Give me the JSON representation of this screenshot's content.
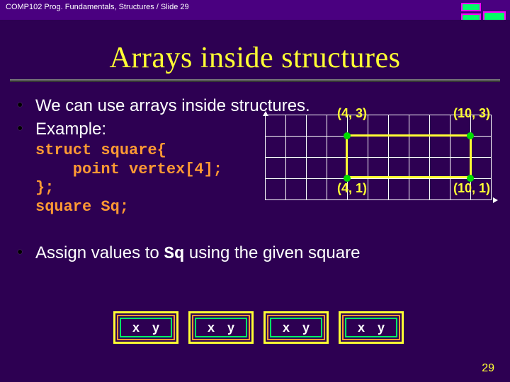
{
  "header": {
    "course": "COMP102 Prog. Fundamentals, Structures / Slide 29"
  },
  "title": "Arrays inside structures",
  "bullets": {
    "b1": "We can use arrays inside structures.",
    "b2": "Example:",
    "b3_pre": "Assign values to ",
    "b3_code": "Sq",
    "b3_post": " using the given square"
  },
  "code": "struct square{\n    point vertex[4];\n};\nsquare Sq;",
  "coords": {
    "tl": "(4, 3)",
    "tr": "(10, 3)",
    "bl": "(4, 1)",
    "br": "(10, 1)"
  },
  "cell_labels": {
    "x": "x",
    "y": "y"
  },
  "page_number": "29",
  "chart_data": {
    "type": "scatter",
    "title": "square vertices",
    "xlabel": "",
    "ylabel": "",
    "series": [
      {
        "name": "vertex",
        "values": [
          {
            "x": 4,
            "y": 3
          },
          {
            "x": 10,
            "y": 3
          },
          {
            "x": 4,
            "y": 1
          },
          {
            "x": 10,
            "y": 1
          }
        ]
      }
    ],
    "xlim": [
      0,
      12
    ],
    "ylim": [
      0,
      4
    ]
  }
}
